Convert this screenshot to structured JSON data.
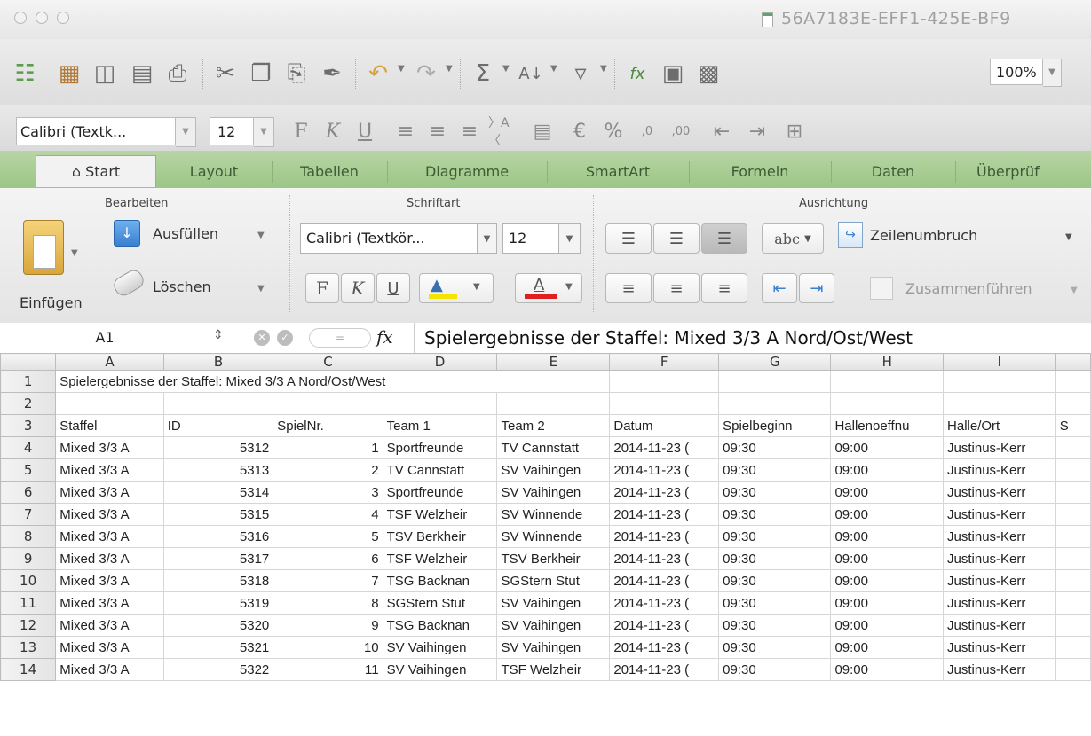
{
  "window": {
    "title": "56A7183E-EFF1-425E-BF9"
  },
  "toolbar": {
    "zoom": "100%"
  },
  "format_bar": {
    "font": "Calibri (Textk...",
    "size": "12"
  },
  "tabs": [
    "Start",
    "Layout",
    "Tabellen",
    "Diagramme",
    "SmartArt",
    "Formeln",
    "Daten",
    "Überprüf"
  ],
  "ribbon": {
    "group_edit": "Bearbeiten",
    "group_font": "Schriftart",
    "group_align": "Ausrichtung",
    "paste": "Einfügen",
    "fill": "Ausfüllen",
    "clear": "Löschen",
    "font": "Calibri (Textkör...",
    "size": "12",
    "wrap": "Zeilenumbruch",
    "merge": "Zusammenführen",
    "abc": "abc"
  },
  "formula_bar": {
    "cell": "A1",
    "fx": "fx",
    "content": "Spielergebnisse der Staffel: Mixed 3/3 A Nord/Ost/West"
  },
  "sheet": {
    "columns": [
      "A",
      "B",
      "C",
      "D",
      "E",
      "F",
      "G",
      "H",
      "I",
      ""
    ],
    "title_row": "Spielergebnisse der Staffel: Mixed 3/3 A Nord/Ost/West",
    "headers": [
      "Staffel",
      "ID",
      "SpielNr.",
      "Team 1",
      "Team 2",
      "Datum",
      "Spielbeginn",
      "Hallenoeffnu",
      "Halle/Ort",
      "S"
    ],
    "rows": [
      [
        "Mixed 3/3 A",
        "5312",
        "1",
        "Sportfreunde",
        "TV Cannstatt",
        "2014-11-23 (",
        "09:30",
        "09:00",
        "Justinus-Kerr"
      ],
      [
        "Mixed 3/3 A",
        "5313",
        "2",
        "TV Cannstatt",
        "SV Vaihingen",
        "2014-11-23 (",
        "09:30",
        "09:00",
        "Justinus-Kerr"
      ],
      [
        "Mixed 3/3 A",
        "5314",
        "3",
        "Sportfreunde",
        "SV Vaihingen",
        "2014-11-23 (",
        "09:30",
        "09:00",
        "Justinus-Kerr"
      ],
      [
        "Mixed 3/3 A",
        "5315",
        "4",
        "TSF Welzheir",
        "SV Winnende",
        "2014-11-23 (",
        "09:30",
        "09:00",
        "Justinus-Kerr"
      ],
      [
        "Mixed 3/3 A",
        "5316",
        "5",
        "TSV Berkheir",
        "SV Winnende",
        "2014-11-23 (",
        "09:30",
        "09:00",
        "Justinus-Kerr"
      ],
      [
        "Mixed 3/3 A",
        "5317",
        "6",
        "TSF Welzheir",
        "TSV Berkheir",
        "2014-11-23 (",
        "09:30",
        "09:00",
        "Justinus-Kerr"
      ],
      [
        "Mixed 3/3 A",
        "5318",
        "7",
        "TSG Backnan",
        "SGStern Stut",
        "2014-11-23 (",
        "09:30",
        "09:00",
        "Justinus-Kerr"
      ],
      [
        "Mixed 3/3 A",
        "5319",
        "8",
        "SGStern Stut",
        "SV Vaihingen",
        "2014-11-23 (",
        "09:30",
        "09:00",
        "Justinus-Kerr"
      ],
      [
        "Mixed 3/3 A",
        "5320",
        "9",
        "TSG Backnan",
        "SV Vaihingen",
        "2014-11-23 (",
        "09:30",
        "09:00",
        "Justinus-Kerr"
      ],
      [
        "Mixed 3/3 A",
        "5321",
        "10",
        "SV Vaihingen",
        "SV Vaihingen",
        "2014-11-23 (",
        "09:30",
        "09:00",
        "Justinus-Kerr"
      ],
      [
        "Mixed 3/3 A",
        "5322",
        "11",
        "SV Vaihingen",
        "TSF Welzheir",
        "2014-11-23 (",
        "09:30",
        "09:00",
        "Justinus-Kerr"
      ]
    ]
  },
  "colors": {
    "tab_bar": "#9cc686",
    "highlight": "#f5e400",
    "font_color": "#e02020"
  }
}
